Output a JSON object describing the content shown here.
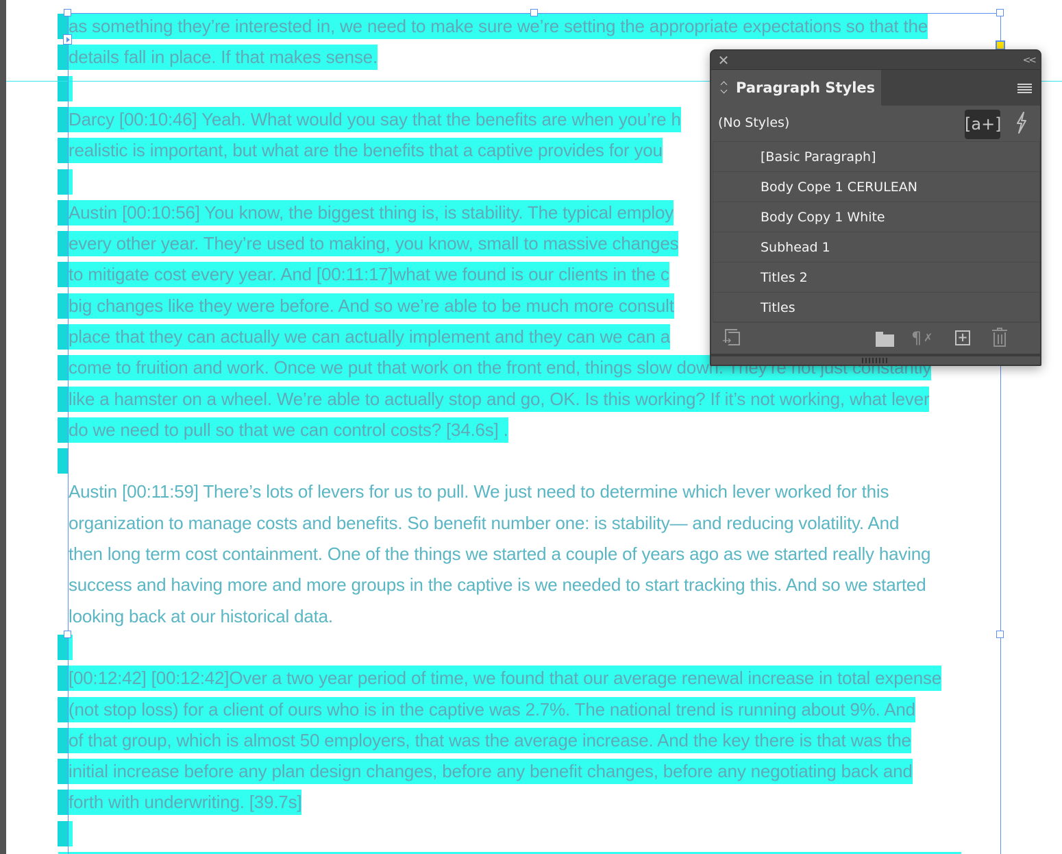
{
  "document": {
    "paragraphs": [
      {
        "id": "p0",
        "selected": true,
        "lines": [
          "as something they’re interested in, we need to make sure we’re setting the appropriate expectations so that the",
          "details fall in place. If that makes sense."
        ]
      },
      {
        "id": "p1",
        "selected": true,
        "lines": [
          "Darcy [00:10:46] Yeah. What would you say that the benefits are when you’re h",
          "realistic is important, but what are the benefits that a captive provides for you"
        ]
      },
      {
        "id": "p2",
        "selected": true,
        "lines": [
          "Austin [00:10:56] You know, the biggest thing is, is stability. The typical employ",
          "every other year. They’re used to making, you know, small to massive changes",
          "to mitigate cost every year. And [00:11:17]what we found is our clients in the c",
          "big changes like they were before. And so we’re able to be much more consult",
          "place that they can actually we can actually implement and they can we can a",
          "come to fruition and work. Once we put that work on the front end, things slow down. They’re not just constantly",
          "like a hamster on a wheel. We’re able to actually stop and go, OK. Is this working? If it’s not working, what lever",
          "do we need to pull so that we can control costs? [34.6s]  ."
        ]
      },
      {
        "id": "p3",
        "selected": false,
        "lines": [
          "Austin [00:11:59] There’s lots of levers for us to pull. We just need to determine which lever worked for this",
          "organization to manage costs and benefits. So benefit number one: is stability— and reducing volatility. And",
          "then long term cost containment. One of the things we started a couple of years ago as we started really having",
          "success and having more and more groups in the captive is we needed to start tracking this. And so we started",
          "looking back at our historical data."
        ]
      },
      {
        "id": "p4",
        "selected": true,
        "lines": [
          "[00:12:42] [00:12:42]Over a two year period of time, we found that our average renewal increase in total expense",
          "(not stop loss)  for a client of ours who is in the captive was 2.7%. The national trend is running about 9%. And",
          "of that group, which is almost 50 employers, that was the average increase. And the key there is that was the",
          "initial increase before any plan design changes, before any benefit changes, before any negotiating back and",
          "forth with underwriting. [39.7s]"
        ]
      }
    ]
  },
  "panel": {
    "close_icon": "close-icon",
    "collapse_label": "<<",
    "tab_label": "Paragraph Styles",
    "menu_icon": "hamburger-menu-icon",
    "no_styles_label": "(No Styles)",
    "new_style_glyph": "[a+]",
    "quick_apply_glyph": "ϟ",
    "styles": [
      {
        "label": "[Basic Paragraph]"
      },
      {
        "label": "Body Cope 1 CERULEAN"
      },
      {
        "label": "Body Copy 1 White"
      },
      {
        "label": "Subhead 1"
      },
      {
        "label": "Titles 2"
      },
      {
        "label": "Titles"
      }
    ],
    "footer": {
      "clear_glyph": "¶",
      "clear_x": "✗",
      "new_glyph": "+",
      "load_arrow": "→"
    }
  },
  "colors": {
    "selection_highlight": "#33fff0",
    "selection_marker": "#16d8d8",
    "text_cerulean": "#5bb6c4",
    "frame_border": "#5b8ff0",
    "panel_bg": "#535353",
    "out_port": "#ffe100"
  }
}
